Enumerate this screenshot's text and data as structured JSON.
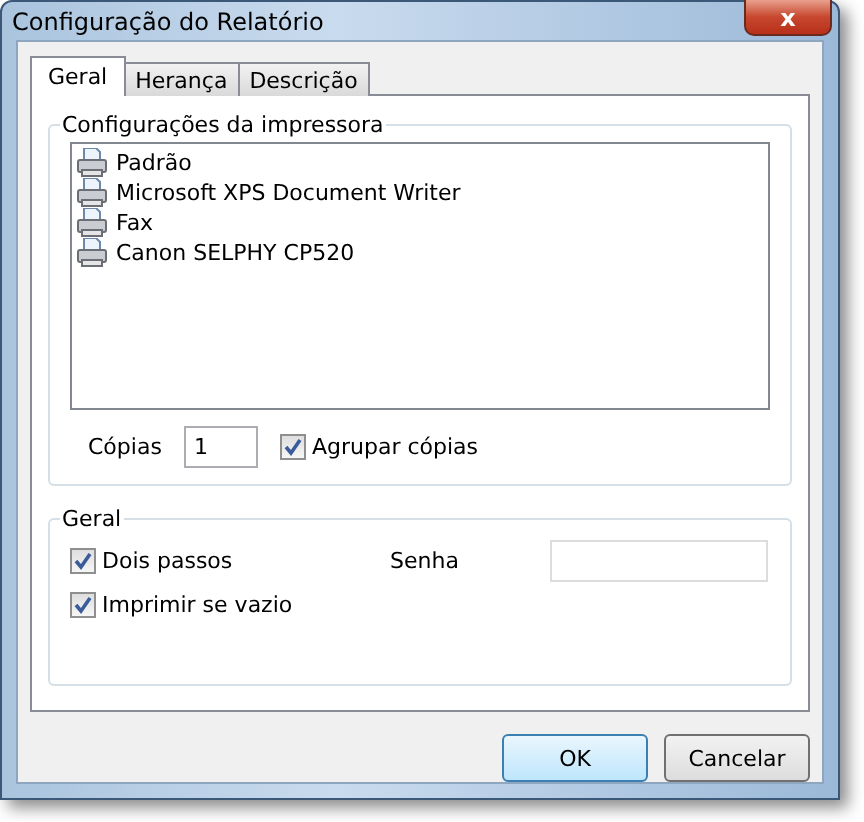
{
  "window": {
    "title": "Configuração do Relatório",
    "close": "x"
  },
  "tabs": [
    {
      "label": "Geral",
      "selected": true
    },
    {
      "label": "Herança",
      "selected": false
    },
    {
      "label": "Descrição",
      "selected": false
    }
  ],
  "printer_group": {
    "title": "Configurações da impressora",
    "printers": [
      "Padrão",
      "Microsoft XPS Document Writer",
      "Fax",
      "Canon SELPHY CP520"
    ],
    "copies_label": "Cópias",
    "copies_value": "1",
    "collate": {
      "label": "Agrupar cópias",
      "checked": true
    }
  },
  "general_group": {
    "title": "Geral",
    "two_pass": {
      "label": "Dois passos",
      "checked": true
    },
    "print_if_empty": {
      "label": "Imprimir se vazio",
      "checked": true
    },
    "password_label": "Senha"
  },
  "buttons": [
    {
      "label": "OK",
      "default": true
    },
    {
      "label": "Cancelar",
      "default": false
    }
  ]
}
